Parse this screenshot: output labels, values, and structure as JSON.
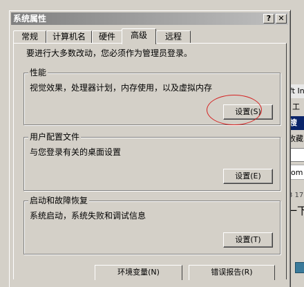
{
  "background_window": {
    "strip1": "ft In",
    "strip2": "工",
    "strip3": "搜",
    "strip4": "收藏",
    "strip6": "com",
    "strip7": "3 17",
    "strip8": "一下"
  },
  "window": {
    "title": "系统属性",
    "help_button": "?",
    "close_button": "✕"
  },
  "tabs": [
    {
      "label": "常规"
    },
    {
      "label": "计算机名"
    },
    {
      "label": "硬件"
    },
    {
      "label": "高级"
    },
    {
      "label": "远程"
    }
  ],
  "active_tab": "高级",
  "admin_note": "要进行大多数改动，您必须作为管理员登录。",
  "groups": {
    "performance": {
      "legend": "性能",
      "desc": "视觉效果，处理器计划，内存使用，以及虚拟内存",
      "button": "设置(S)"
    },
    "profiles": {
      "legend": "用户配置文件",
      "desc": "与您登录有关的桌面设置",
      "button": "设置(E)"
    },
    "startup": {
      "legend": "启动和故障恢复",
      "desc": "系统启动，系统失败和调试信息",
      "button": "设置(T)"
    }
  },
  "bottom_buttons": {
    "env": "环境变量(N)",
    "errors": "错误报告(R)"
  },
  "colors": {
    "face": "#d4d0c8",
    "annotation": "#d42020",
    "title_inactive_start": "#808080"
  }
}
